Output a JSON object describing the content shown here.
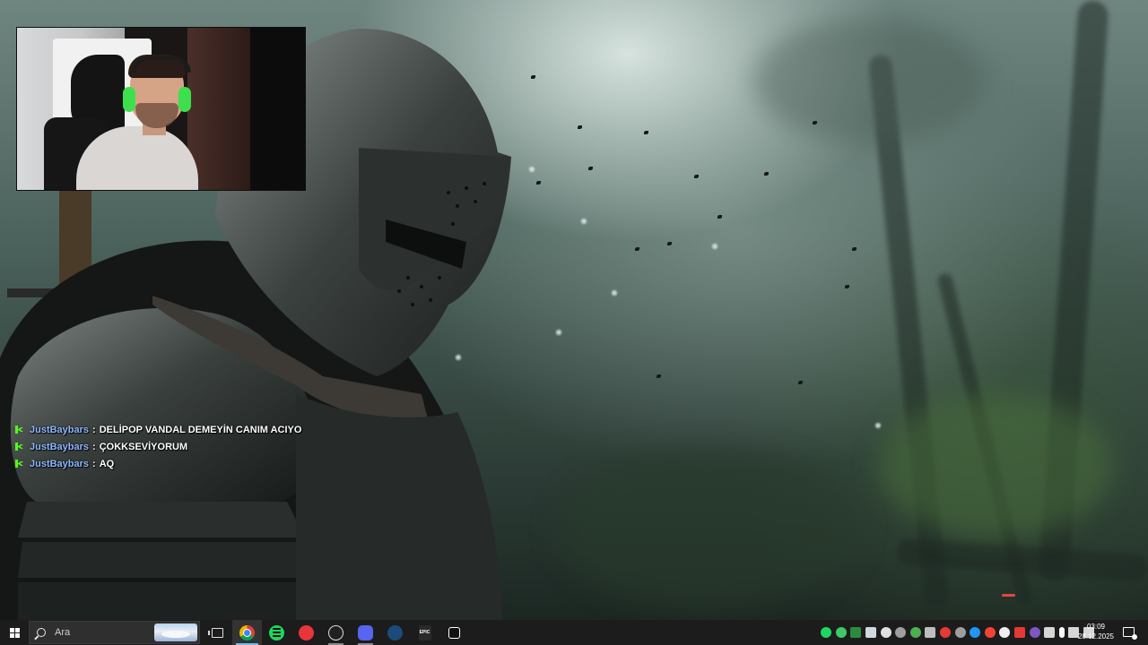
{
  "chat": {
    "messages": [
      {
        "user": "JustBaybars",
        "separator": ":",
        "text": "DELİPOP VANDAL DEMEYİN CANIM ACIYO"
      },
      {
        "user": "JustBaybars",
        "separator": ":",
        "text": "ÇOKKSEVİYORUM"
      },
      {
        "user": "JustBaybars",
        "separator": ":",
        "text": "AQ"
      }
    ],
    "platform_icon": "kick-icon",
    "user_color": "#8eb8ff"
  },
  "taskbar": {
    "search": {
      "placeholder": "Ara"
    },
    "pinned": [
      {
        "name": "task-view",
        "icon": "taskview-icon"
      },
      {
        "name": "chrome",
        "icon": "chrome-icon",
        "state": "active"
      },
      {
        "name": "spotify",
        "icon": "spotify-icon"
      },
      {
        "name": "app-red",
        "icon": "pin-icon"
      },
      {
        "name": "obs",
        "icon": "obs-icon",
        "state": "open"
      },
      {
        "name": "discord",
        "icon": "discord-icon",
        "state": "open"
      },
      {
        "name": "steam",
        "icon": "steam-icon"
      },
      {
        "name": "epic-games",
        "icon": "epic-icon",
        "label": "EPIC"
      },
      {
        "name": "capcut",
        "icon": "capcut-icon"
      }
    ],
    "clock": {
      "time": "03:09",
      "date": "28.12.2025"
    }
  },
  "colors": {
    "taskbar_bg": "#1c1c1c",
    "active_indicator": "#76b9ed",
    "kick_green": "#53fc18"
  }
}
